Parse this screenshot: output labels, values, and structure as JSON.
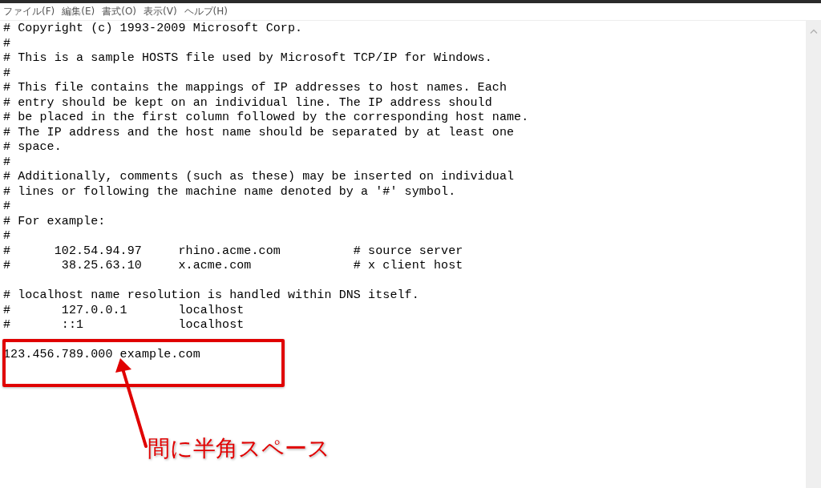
{
  "menu": [
    {
      "label": "ファイル(F)"
    },
    {
      "label": "編集(E)"
    },
    {
      "label": "書式(O)"
    },
    {
      "label": "表示(V)"
    },
    {
      "label": "ヘルプ(H)"
    }
  ],
  "editor": {
    "blocks": [
      [
        "# Copyright (c) 1993-2009 Microsoft Corp.",
        "#",
        "# This is a sample HOSTS file used by Microsoft TCP/IP for Windows.",
        "#",
        "# This file contains the mappings of IP addresses to host names. Each",
        "# entry should be kept on an individual line. The IP address should",
        "# be placed in the first column followed by the corresponding host name.",
        "# The IP address and the host name should be separated by at least one",
        "# space.",
        "#",
        "# Additionally, comments (such as these) may be inserted on individual",
        "# lines or following the machine name denoted by a '#' symbol.",
        "#",
        "# For example:",
        "#",
        "#      102.54.94.97     rhino.acme.com          # source server",
        "#       38.25.63.10     x.acme.com              # x client host"
      ],
      [
        "# localhost name resolution is handled within DNS itself.",
        "#       127.0.0.1       localhost",
        "#       ::1             localhost"
      ],
      [
        "123.456.789.000 example.com"
      ]
    ]
  },
  "annotation": {
    "label": "間に半角スペース"
  }
}
